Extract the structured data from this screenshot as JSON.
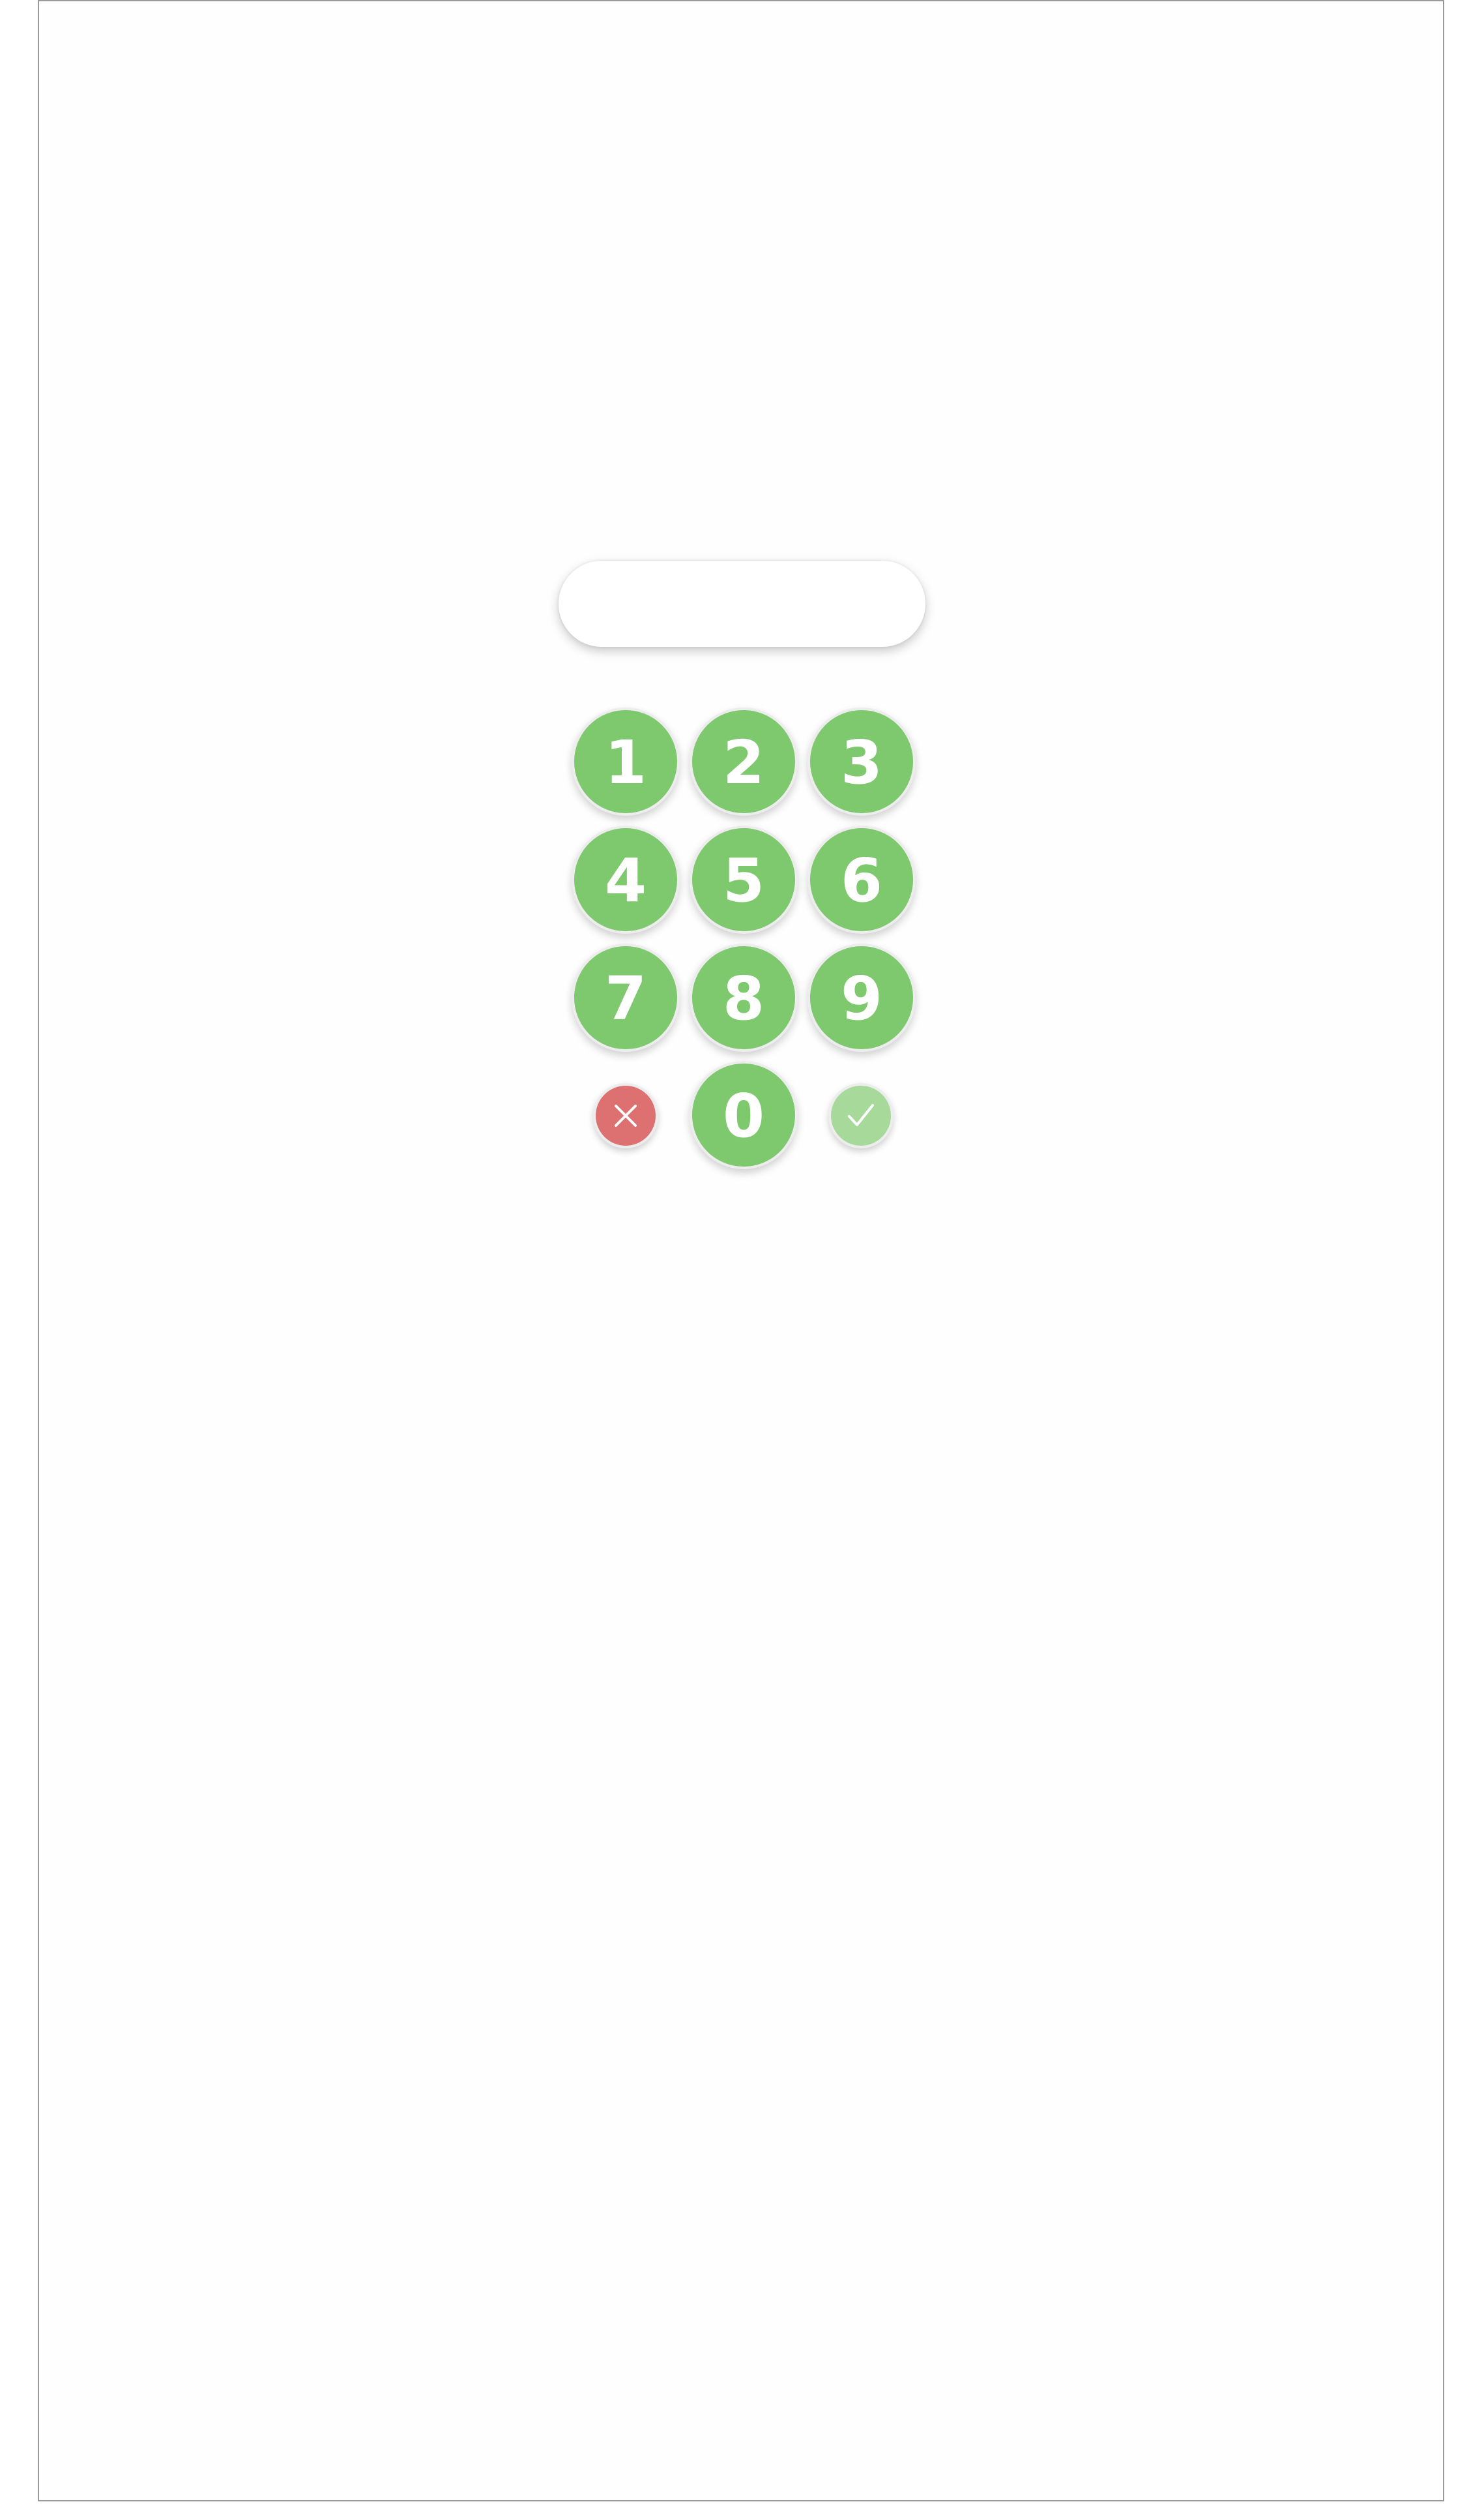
{
  "display": {
    "value": ""
  },
  "keypad": {
    "keys": [
      "1",
      "2",
      "3",
      "4",
      "5",
      "6",
      "7",
      "8",
      "9",
      "0"
    ],
    "clear_icon": "close-icon",
    "confirm_icon": "check-icon"
  },
  "colors": {
    "key": "#7ec86e",
    "clear": "#dd7070",
    "confirm": "#a6d99a",
    "key_text": "#ffffff"
  }
}
